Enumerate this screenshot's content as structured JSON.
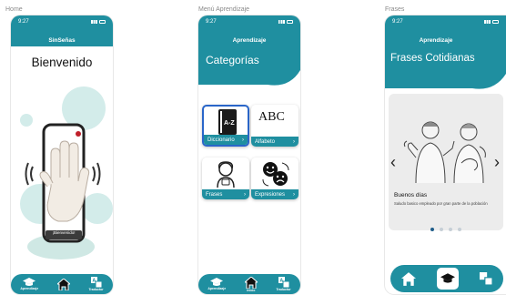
{
  "labels": {
    "home": "Home",
    "menu": "Menú Aprendizaje",
    "frases": "Frases"
  },
  "status": {
    "time": "9:27"
  },
  "home": {
    "header": "SinSeñas",
    "title": "Bienvenido",
    "phone_caption": "¡Bienvenido!",
    "nav": [
      {
        "label": "Aprendizaje",
        "icon": "graduation-cap-icon"
      },
      {
        "label": "",
        "icon": "home-icon"
      },
      {
        "label": "Traductor",
        "icon": "translate-icon"
      }
    ]
  },
  "menu": {
    "header": "Aprendizaje",
    "title": "Categorías",
    "cards": [
      {
        "label": "Diccionario",
        "icon": "dictionary-icon",
        "text": "A-Z"
      },
      {
        "label": "Alfabeto",
        "icon": "alphabet-icon",
        "text": "ABC"
      },
      {
        "label": "Frases",
        "icon": "person-speaking-icon"
      },
      {
        "label": "Expresiones",
        "icon": "emotions-icon"
      }
    ],
    "nav": [
      {
        "label": "Aprendizaje",
        "icon": "graduation-cap-icon"
      },
      {
        "label": "Inicio",
        "icon": "home-icon"
      },
      {
        "label": "Traductor",
        "icon": "translate-icon"
      }
    ]
  },
  "frases": {
    "header": "Aprendizaje",
    "title": "Frases Cotidianas",
    "phrase": "Buenos días",
    "description": "Saludo basico empleado por gran parte de la población",
    "dots": 4,
    "active_dot": 0
  },
  "colors": {
    "primary": "#1f8fa0",
    "circle": "#d3ecea",
    "active_dot": "#1f5d8a"
  }
}
